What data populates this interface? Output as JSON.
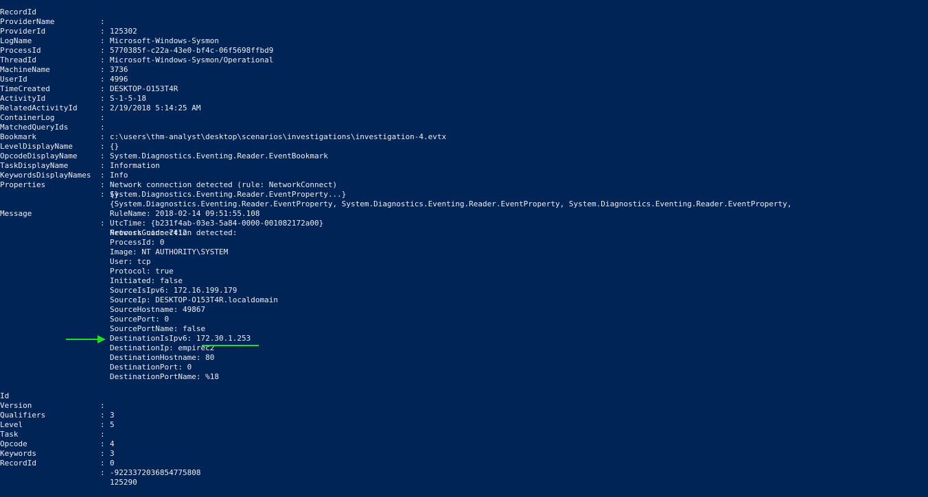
{
  "console": {
    "background": "#012456",
    "foreground": "#eeedf0",
    "annotation_color": "#22dd22",
    "separator": ":",
    "top_fields": [
      {
        "key": "RecordId",
        "value": "125302"
      },
      {
        "key": "ProviderName",
        "value": "Microsoft-Windows-Sysmon"
      },
      {
        "key": "ProviderId",
        "value": "5770385f-c22a-43e0-bf4c-06f5698ffbd9"
      },
      {
        "key": "LogName",
        "value": "Microsoft-Windows-Sysmon/Operational"
      },
      {
        "key": "ProcessId",
        "value": "3736"
      },
      {
        "key": "ThreadId",
        "value": "4996"
      },
      {
        "key": "MachineName",
        "value": "DESKTOP-O153T4R"
      },
      {
        "key": "UserId",
        "value": "S-1-5-18"
      },
      {
        "key": "TimeCreated",
        "value": "2/19/2018 5:14:25 AM"
      },
      {
        "key": "ActivityId",
        "value": ""
      },
      {
        "key": "RelatedActivityId",
        "value": ""
      },
      {
        "key": "ContainerLog",
        "value": "c:\\users\\thm-analyst\\desktop\\scenarios\\investigations\\investigation-4.evtx"
      },
      {
        "key": "MatchedQueryIds",
        "value": "{}"
      },
      {
        "key": "Bookmark",
        "value": "System.Diagnostics.Eventing.Reader.EventBookmark"
      },
      {
        "key": "LevelDisplayName",
        "value": "Information"
      },
      {
        "key": "OpcodeDisplayName",
        "value": "Info"
      },
      {
        "key": "TaskDisplayName",
        "value": "Network connection detected (rule: NetworkConnect)"
      },
      {
        "key": "KeywordsDisplayNames",
        "value": "{}"
      },
      {
        "key": "Properties",
        "value": "{System.Diagnostics.Eventing.Reader.EventProperty, System.Diagnostics.Eventing.Reader.EventProperty, System.Diagnostics.Eventing.Reader.EventProperty,"
      }
    ],
    "properties_continuation": "System.Diagnostics.Eventing.Reader.EventProperty...}",
    "message": {
      "key": "Message",
      "lines": [
        "Network connection detected:",
        "RuleName: 2018-02-14 09:51:55.108",
        "UtcTime: {b231f4ab-03e3-5a84-0000-001082172a00}",
        "ProcessGuid: 7412",
        "ProcessId: 0",
        "Image: NT AUTHORITY\\SYSTEM",
        "User: tcp",
        "Protocol: true",
        "Initiated: false",
        "SourceIsIpv6: 172.16.199.179",
        "SourceIp: DESKTOP-O153T4R.localdomain",
        "SourceHostname: 49867",
        "SourcePort: 0",
        "SourcePortName: false",
        "DestinationIsIpv6: 172.30.1.253",
        "DestinationIp: empirec2",
        "DestinationHostname: 80",
        "DestinationPort: 0",
        "DestinationPortName: %18"
      ]
    },
    "bottom_fields": [
      {
        "key": "Id",
        "value": "3"
      },
      {
        "key": "Version",
        "value": "5"
      },
      {
        "key": "Qualifiers",
        "value": ""
      },
      {
        "key": "Level",
        "value": "4"
      },
      {
        "key": "Task",
        "value": "3"
      },
      {
        "key": "Opcode",
        "value": "0"
      },
      {
        "key": "Keywords",
        "value": "-9223372036854775808"
      },
      {
        "key": "RecordId",
        "value": "125290"
      }
    ]
  }
}
